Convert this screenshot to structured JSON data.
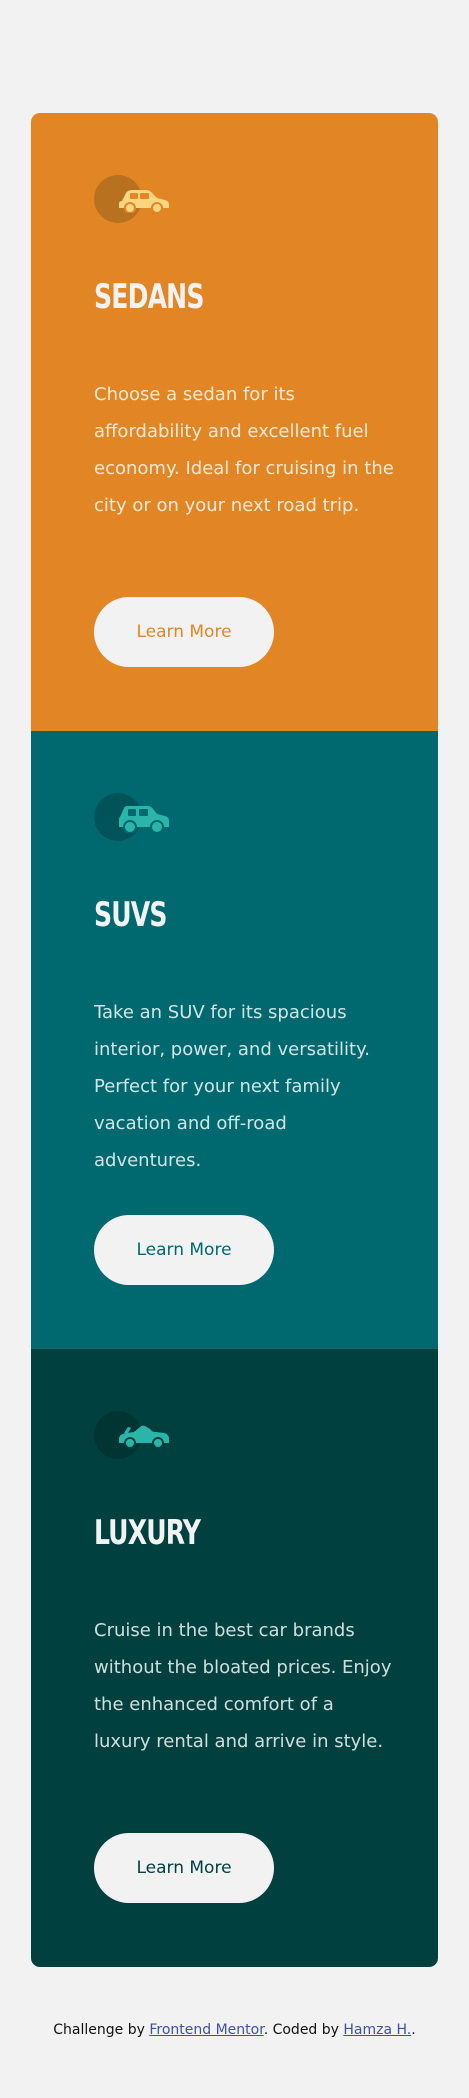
{
  "cards": [
    {
      "icon": "sedan-car-icon",
      "title": "SEDANS",
      "text": "Choose a sedan for its affordability and excellent fuel economy. Ideal for cruising in the city or on your next road trip.",
      "button_label": "Learn More",
      "color": "#e28625"
    },
    {
      "icon": "suv-car-icon",
      "title": "SUVS",
      "text": "Take an SUV for its spacious interior, power, and versatility. Perfect for your next family vacation and off-road adventures.",
      "button_label": "Learn More",
      "color": "#006970"
    },
    {
      "icon": "luxury-car-icon",
      "title": "LUXURY",
      "text": "Cruise in the best car brands without the bloated prices. Enjoy the enhanced comfort of a luxury rental and arrive in style.",
      "button_label": "Learn More",
      "color": "#004140"
    }
  ],
  "attribution": {
    "prefix": "Challenge by ",
    "challenge_link": "Frontend Mentor",
    "middle": ". Coded by ",
    "author_link": "Hamza H.",
    "suffix": "."
  },
  "colors": {
    "background": "#f2f2f2",
    "sedans": "#e28625",
    "suvs": "#006970",
    "luxury": "#004140",
    "sedan_icon": "#fcd581",
    "suv_icon": "#2bb5a9",
    "luxury_icon": "#2bb5a9"
  }
}
